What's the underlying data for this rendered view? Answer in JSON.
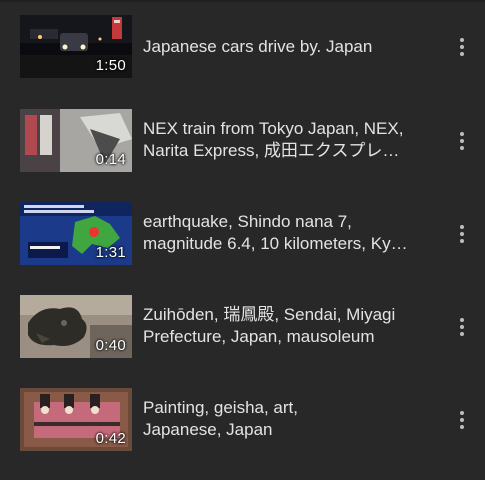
{
  "videos": [
    {
      "title_lines": [
        "Japanese cars drive by. Japan"
      ],
      "duration": "1:50",
      "thumbnail": "night-street-cars-icon"
    },
    {
      "title_lines": [
        "NEX train from Tokyo Japan, NEX,",
        "Narita Express, 成田エクスプレ…"
      ],
      "duration": "0:14",
      "thumbnail": "train-door-icon"
    },
    {
      "title_lines": [
        "earthquake, Shindo nana 7,",
        "magnitude 6.4, 10 kilometers, Ky…"
      ],
      "duration": "1:31",
      "thumbnail": "earthquake-map-icon"
    },
    {
      "title_lines": [
        "Zuihōden, 瑞鳳殿, Sendai, Miyagi",
        "Prefecture, Japan, mausoleum"
      ],
      "duration": "0:40",
      "thumbnail": "dragon-carving-icon"
    },
    {
      "title_lines": [
        "Painting, geisha, art,",
        "Japanese, Japan"
      ],
      "duration": "0:42",
      "thumbnail": "geisha-painting-icon"
    }
  ]
}
